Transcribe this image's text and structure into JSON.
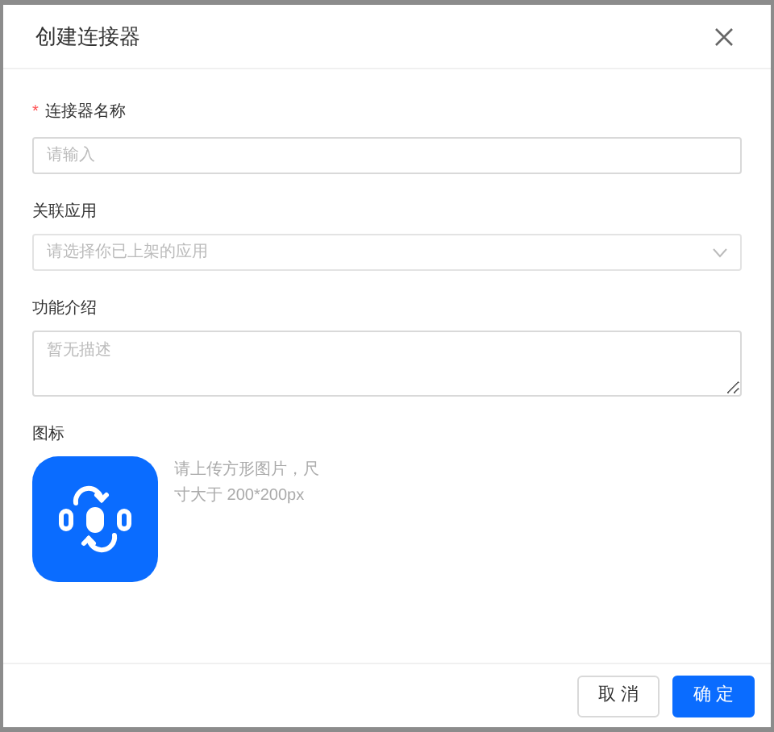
{
  "dialog": {
    "title": "创建连接器"
  },
  "fields": [
    {
      "kind": "input",
      "required_mark": "*",
      "label": "连接器名称",
      "placeholder": "请输入"
    },
    {
      "kind": "select",
      "label": "关联应用",
      "placeholder": "请选择你已上架的应用"
    },
    {
      "kind": "textarea",
      "label": "功能介绍",
      "placeholder": "暂无描述"
    }
  ],
  "icon_upload": {
    "label": "图标",
    "hint": "请上传方形图片，尺寸大于 200*200px"
  },
  "buttons": [
    {
      "label": "取 消",
      "primary": false
    },
    {
      "label": "确 定",
      "primary": true
    }
  ]
}
